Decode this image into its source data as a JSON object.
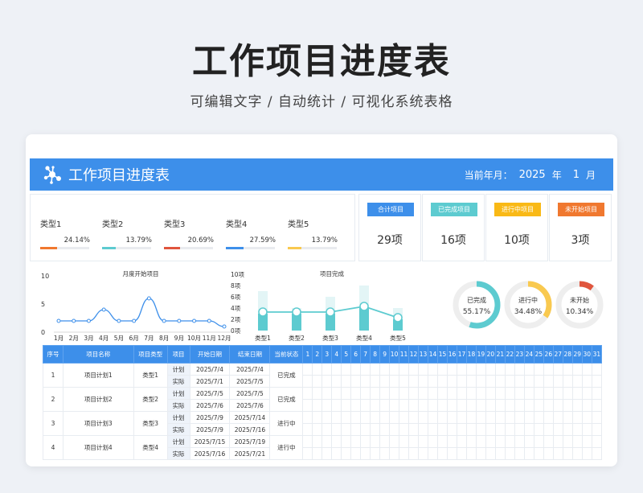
{
  "page": {
    "title": "工作项目进度表",
    "subtitle": "可编辑文字 / 自动统计 / 可视化系统表格"
  },
  "banner": {
    "title": "工作项目进度表",
    "date_label": "当前年月：",
    "year": "2025",
    "year_unit": "年",
    "month": "1",
    "month_unit": "月"
  },
  "colors": {
    "brand": "#3d8fea",
    "teal": "#5dcbd0",
    "orange": "#f0782f",
    "red": "#e0553d",
    "blue": "#3d8fea",
    "yellow": "#f9c94f"
  },
  "types": [
    {
      "name": "类型1",
      "pct": "24.14%",
      "value": 24.14,
      "color": "#f0782f"
    },
    {
      "name": "类型2",
      "pct": "13.79%",
      "value": 13.79,
      "color": "#5dcbd0"
    },
    {
      "name": "类型3",
      "pct": "20.69%",
      "value": 20.69,
      "color": "#e0553d"
    },
    {
      "name": "类型4",
      "pct": "27.59%",
      "value": 27.59,
      "color": "#3d8fea"
    },
    {
      "name": "类型5",
      "pct": "13.79%",
      "value": 13.79,
      "color": "#f9c94f"
    }
  ],
  "summary": [
    {
      "label": "合计项目",
      "value": "29项",
      "color": "#3d8fea"
    },
    {
      "label": "已完成项目",
      "value": "16项",
      "color": "#5dcbd0"
    },
    {
      "label": "进行中项目",
      "value": "10项",
      "color": "#f9b916"
    },
    {
      "label": "未开始项目",
      "value": "3项",
      "color": "#f0782f"
    }
  ],
  "chart_data": [
    {
      "type": "line",
      "title": "月度开始项目",
      "categories": [
        "1月",
        "2月",
        "3月",
        "4月",
        "5月",
        "6月",
        "7月",
        "8月",
        "9月",
        "10月",
        "11月",
        "12月"
      ],
      "values": [
        2,
        2,
        2,
        4,
        2,
        2,
        6,
        2,
        2,
        2,
        2,
        1
      ],
      "ylim": [
        0,
        10
      ],
      "yticks": [
        "0",
        "5",
        "10"
      ]
    },
    {
      "type": "bar",
      "title": "项目完成",
      "categories": [
        "类型1",
        "类型2",
        "类型3",
        "类型4",
        "类型5"
      ],
      "series": [
        {
          "values": [
            7,
            4,
            6,
            8,
            4
          ]
        },
        {
          "values": [
            3,
            3,
            3,
            4,
            2
          ]
        }
      ],
      "ylim": [
        0,
        10
      ],
      "yticks": [
        "0项",
        "2项",
        "4项",
        "6项",
        "8项",
        "10项"
      ]
    },
    {
      "type": "pie",
      "donuts": [
        {
          "label": "已完成",
          "pct": "55.17%",
          "value": 55.17,
          "color": "#5dcbd0"
        },
        {
          "label": "进行中",
          "pct": "34.48%",
          "value": 34.48,
          "color": "#f9c94f"
        },
        {
          "label": "未开始",
          "pct": "10.34%",
          "value": 10.34,
          "color": "#e0553d"
        }
      ]
    }
  ],
  "gantt": {
    "headers": [
      "序号",
      "项目名称",
      "项目类型",
      "项目",
      "开始日期",
      "结束日期",
      "当前状态"
    ],
    "days": [
      "1",
      "2",
      "3",
      "4",
      "5",
      "6",
      "7",
      "8",
      "9",
      "10",
      "11",
      "12",
      "13",
      "14",
      "15",
      "16",
      "17",
      "18",
      "19",
      "20",
      "21",
      "22",
      "23",
      "24",
      "25",
      "26",
      "27",
      "28",
      "29",
      "30",
      "31"
    ],
    "rows": [
      {
        "no": "1",
        "name": "项目计划1",
        "type": "类型1",
        "status": "已完成",
        "plan": {
          "kind": "计划",
          "start": "2025/7/4",
          "end": "2025/7/4"
        },
        "actual": {
          "kind": "实际",
          "start": "2025/7/1",
          "end": "2025/7/5"
        }
      },
      {
        "no": "2",
        "name": "项目计划2",
        "type": "类型2",
        "status": "已完成",
        "plan": {
          "kind": "计划",
          "start": "2025/7/5",
          "end": "2025/7/5"
        },
        "actual": {
          "kind": "实际",
          "start": "2025/7/6",
          "end": "2025/7/6"
        }
      },
      {
        "no": "3",
        "name": "项目计划3",
        "type": "类型3",
        "status": "进行中",
        "plan": {
          "kind": "计划",
          "start": "2025/7/9",
          "end": "2025/7/14"
        },
        "actual": {
          "kind": "实际",
          "start": "2025/7/9",
          "end": "2025/7/16"
        }
      },
      {
        "no": "4",
        "name": "项目计划4",
        "type": "类型4",
        "status": "进行中",
        "plan": {
          "kind": "计划",
          "start": "2025/7/15",
          "end": "2025/7/19"
        },
        "actual": {
          "kind": "实际",
          "start": "2025/7/16",
          "end": "2025/7/21"
        }
      }
    ]
  }
}
